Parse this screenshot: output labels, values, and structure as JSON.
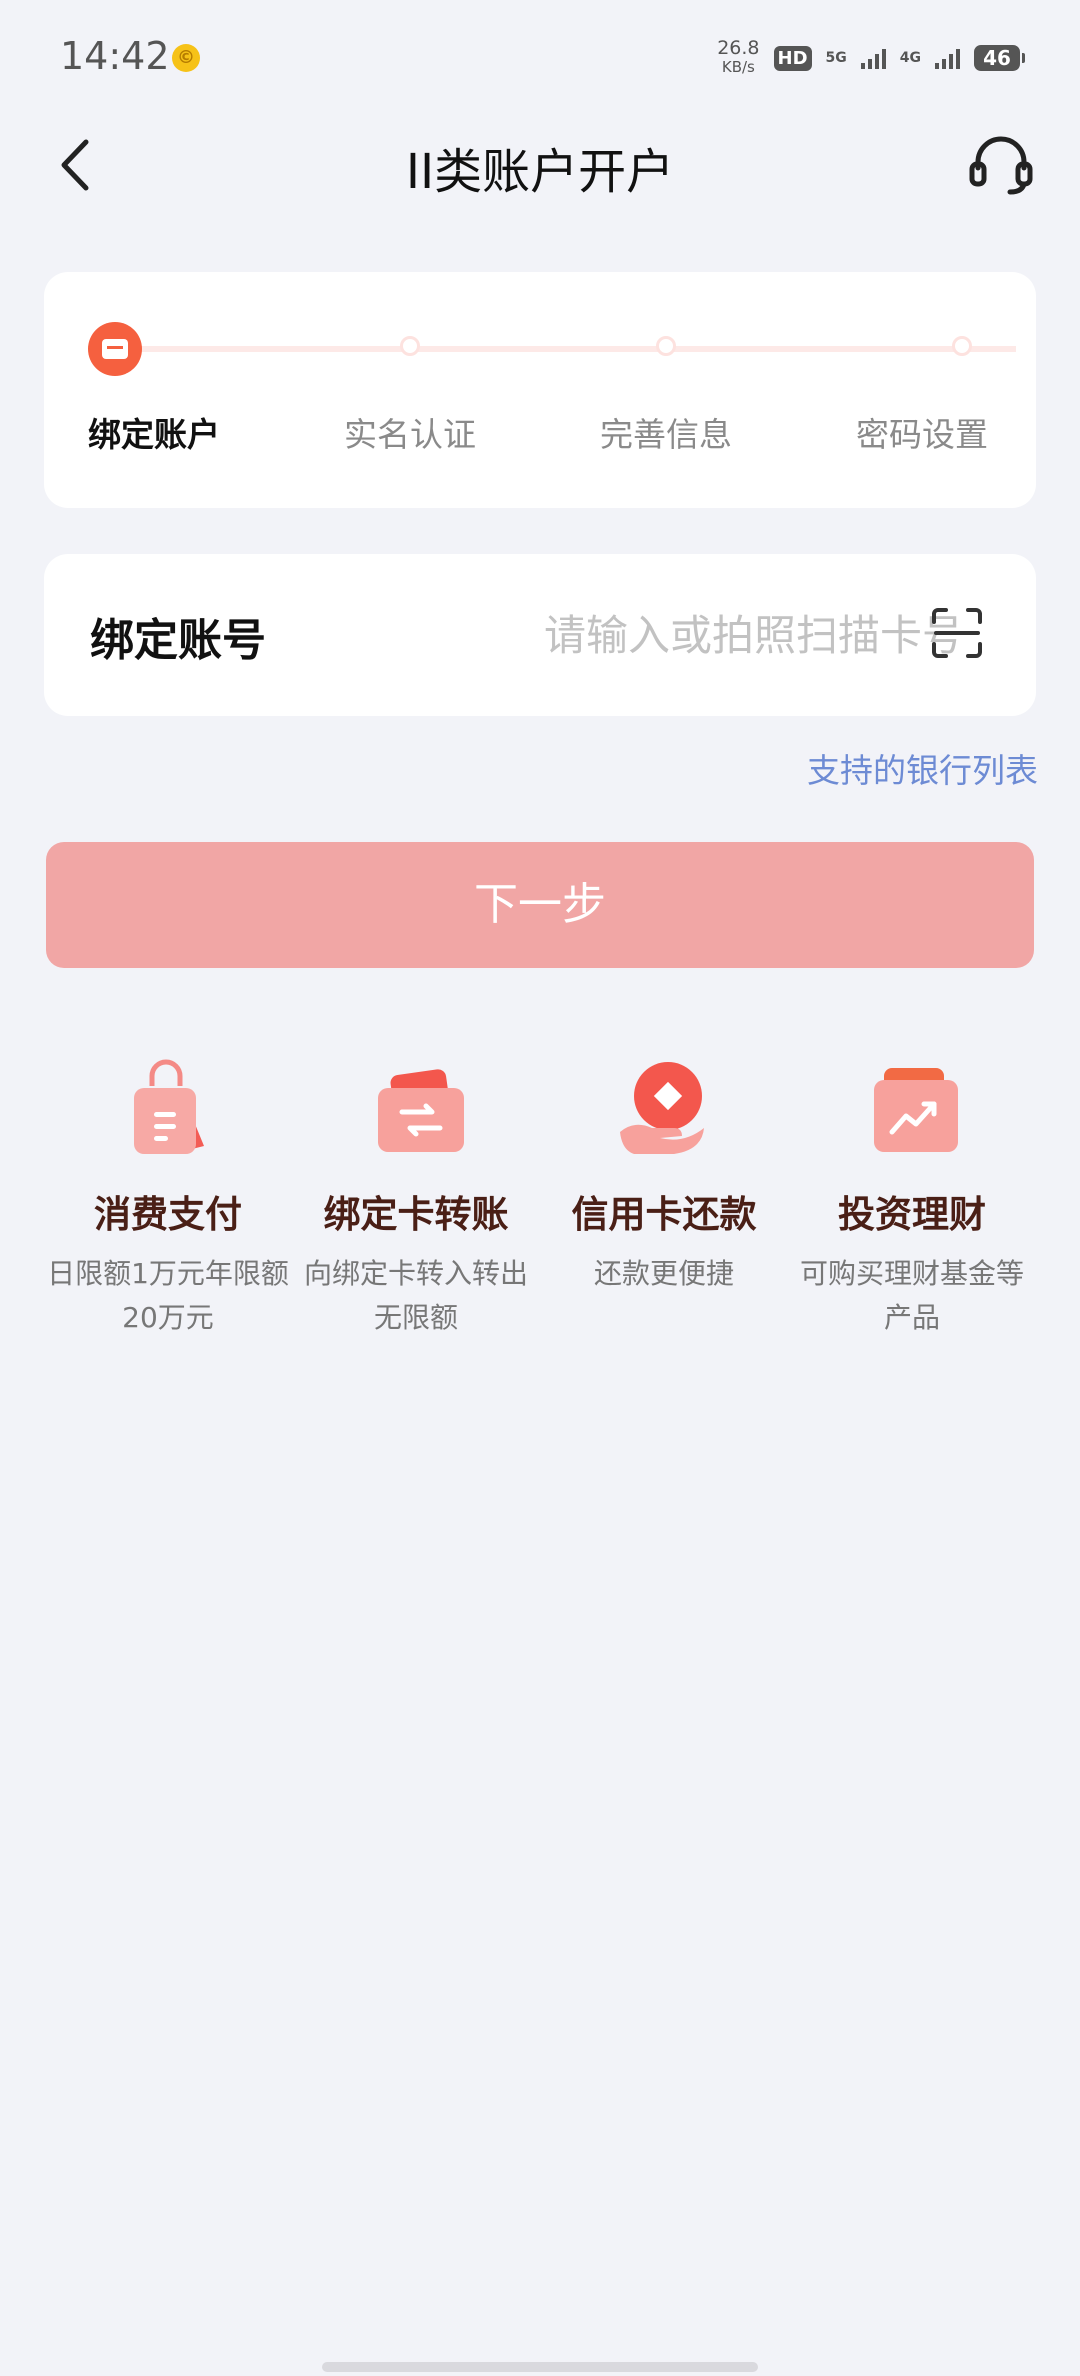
{
  "status_bar": {
    "time": "14:42",
    "speed_value": "26.8",
    "speed_unit": "KB/s",
    "hd": "HD",
    "net1": "5G",
    "net2": "4G",
    "battery": "46"
  },
  "header": {
    "title": "II类账户开户"
  },
  "steps": [
    {
      "label": "绑定账户",
      "active": true
    },
    {
      "label": "实名认证",
      "active": false
    },
    {
      "label": "完善信息",
      "active": false
    },
    {
      "label": "密码设置",
      "active": false
    }
  ],
  "form": {
    "label": "绑定账号",
    "placeholder": "请输入或拍照扫描卡号"
  },
  "bank_list_link": "支持的银行列表",
  "next_button": "下一步",
  "features": [
    {
      "title": "消费支付",
      "desc": "日限额1万元年限额20万元",
      "icon": "shopping-bag-icon"
    },
    {
      "title": "绑定卡转账",
      "desc": "向绑定卡转入转出无限额",
      "icon": "card-transfer-icon"
    },
    {
      "title": "信用卡还款",
      "desc": "还款更便捷",
      "icon": "hand-diamond-icon"
    },
    {
      "title": "投资理财",
      "desc": "可购买理财基金等产品",
      "icon": "trend-chart-icon"
    }
  ],
  "colors": {
    "accent": "#f5603f",
    "button_disabled": "#f1a6a5",
    "link": "#6d8bd4",
    "feature_title": "#4a1f16"
  }
}
